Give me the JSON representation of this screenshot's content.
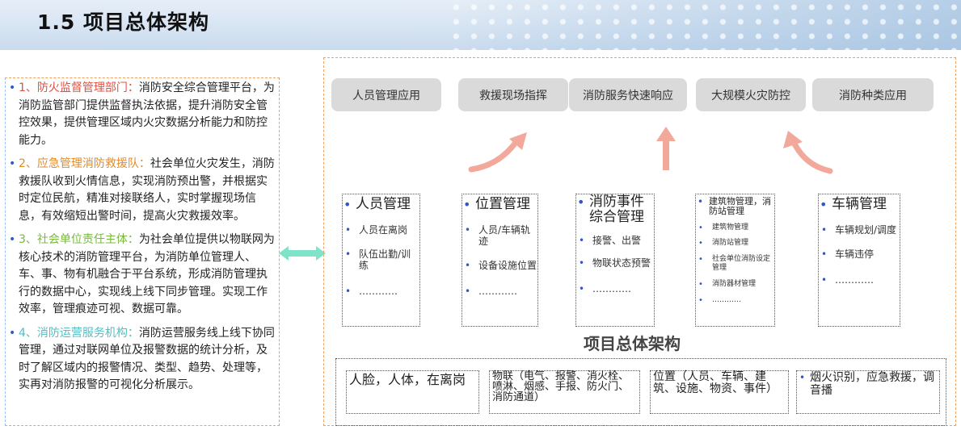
{
  "header": {
    "title": "1.5  项目总体架构"
  },
  "left": {
    "paragraphs": [
      {
        "head": "1、防火监督管理部门：",
        "body": "消防安全综合管理平台，为消防监管部门提供监督执法依据，提升消防安全管控效果，提供管理区域内火灾数据分析能力和防控能力。",
        "color": "#e05040"
      },
      {
        "head": "2、应急管理消防救援队：",
        "body": "社会单位火灾发生，消防救援队收到火情信息，实现消防预出警，并根据实时定位民航，精准对接联络人，实时掌握现场信息，有效缩短出警时间，提高火灾救援效率。",
        "color": "#e38a2a"
      },
      {
        "head": "3、社会单位责任主体：",
        "body": "为社会单位提供以物联网为核心技术的消防管理平台，为消防单位管理人、车、事、物有机融合于平台系统，形成消防管理执行的数据中心，实现线上线下同步管理。实现工作效率，管理痕迹可视、数据可靠。",
        "color": "#7ab840"
      },
      {
        "head": "4、消防运营服务机构：",
        "body": "消防运营服务线上线下协同管理，通过对联网单位及报警数据的统计分析，及时了解区域内的报警情况、类型、趋势、处理等，实再对消防报警的可视化分析展示。",
        "color": "#4fc0c6"
      }
    ]
  },
  "top_buttons": [
    "人员管理应用",
    "救援现场指挥",
    "消防服务快速响应",
    "大规模火灾防控",
    "消防种类应用"
  ],
  "modules": [
    {
      "title": "人员管理",
      "items": [
        "人员在离岗",
        "队伍出勤/训练",
        "…………"
      ]
    },
    {
      "title": "位置管理",
      "items": [
        "人员/车辆轨迹",
        "设备设施位置",
        "…………"
      ]
    },
    {
      "title": "消防事件综合管理",
      "items": [
        "接警、出警",
        "物联状态预警",
        "…………"
      ]
    },
    {
      "title": "建筑物管理，消防站管理",
      "items": [
        "建筑物管理",
        "消防站管理",
        "社会单位消防设定管理",
        "消防器材管理",
        "…………"
      ]
    },
    {
      "title": "车辆管理",
      "items": [
        "车辆规划/调度",
        "车辆违停",
        "…………"
      ]
    }
  ],
  "center_title": "项目总体架构",
  "bottom": [
    "人脸，人体，在离岗",
    "物联（电气、报警、消火栓、喷淋、烟感、手报、防火门、消防通道）",
    "位置（人员、车辆、建筑、设施、物资、事件）",
    "烟火识别，应急救援，调音播"
  ],
  "colors": {
    "bullet": "#3355cc",
    "arrow": "#f2a89a",
    "double_arrow": "#7ee3c8"
  },
  "icons": [
    "up-curve-arrow-icon",
    "up-arrow-icon",
    "double-arrow-icon"
  ]
}
